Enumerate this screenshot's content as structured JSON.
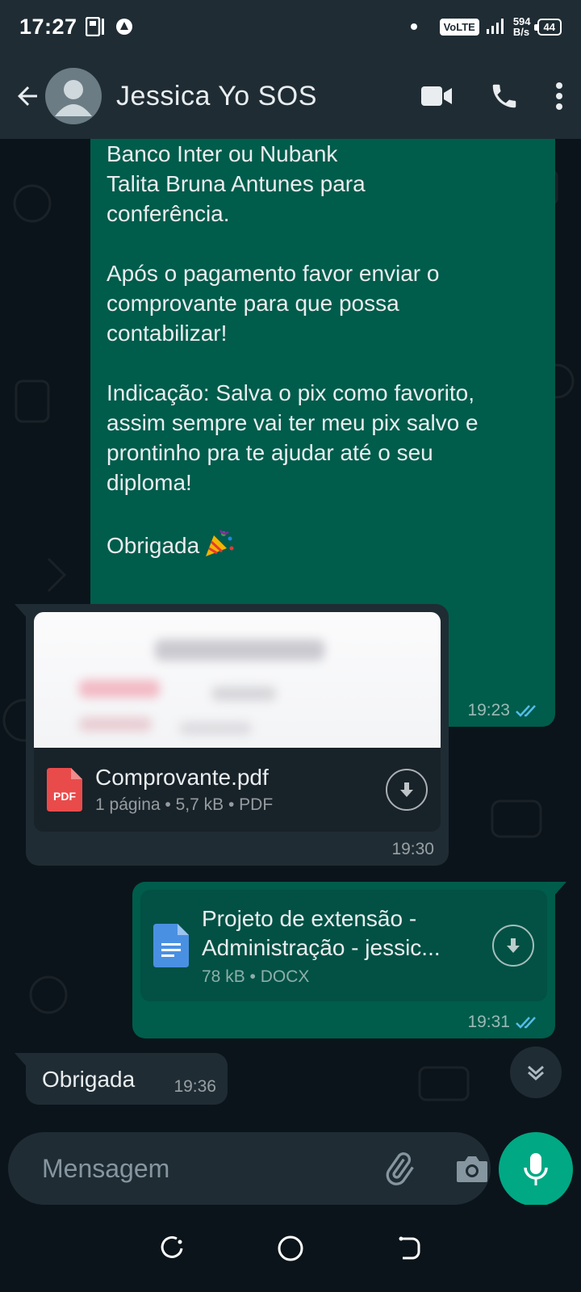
{
  "status_bar": {
    "time": "17:27",
    "network_label": "VoLTE",
    "speed_value": "594",
    "speed_unit": "B/s",
    "battery": "44"
  },
  "header": {
    "contact_name": "Jessica Yo SOS"
  },
  "messages": {
    "m1": {
      "text": "Banco Inter ou Nubank\nTalita Bruna Antunes para\nconferência.\n\nApós o pagamento favor enviar o\ncomprovante para que possa\ncontabilizar!\n\nIndicação: Salva o pix como favorito,\nassim sempre vai ter meu pix salvo e\nprontinho pra te ajudar até o seu\ndiploma!\n\n",
      "closing": "Obrigada",
      "time": "19:23"
    },
    "m2": {
      "file_badge": "PDF",
      "file_name": "Comprovante.pdf",
      "file_meta": "1 página • 5,7 kB • PDF",
      "time": "19:30"
    },
    "m3": {
      "file_name_line1": "Projeto de extensão -",
      "file_name_line2": "Administração - jessic...",
      "file_meta": "78 kB • DOCX",
      "time": "19:31"
    },
    "m4": {
      "text": "Obrigada",
      "time": "19:36"
    }
  },
  "composer": {
    "placeholder": "Mensagem"
  },
  "colors": {
    "outgoing_bubble": "#005c4b",
    "incoming_bubble": "#1f2c34",
    "accent": "#00a884",
    "read_ticks": "#53bdeb"
  },
  "icons": [
    "back-arrow-icon",
    "avatar-icon",
    "video-call-icon",
    "phone-icon",
    "more-options-icon",
    "pdf-file-icon",
    "download-icon",
    "docx-file-icon",
    "double-check-icon",
    "chevron-down-icon",
    "emoji-icon",
    "attach-icon",
    "camera-icon",
    "mic-icon",
    "recent-apps-icon",
    "home-icon",
    "back-nav-icon"
  ]
}
